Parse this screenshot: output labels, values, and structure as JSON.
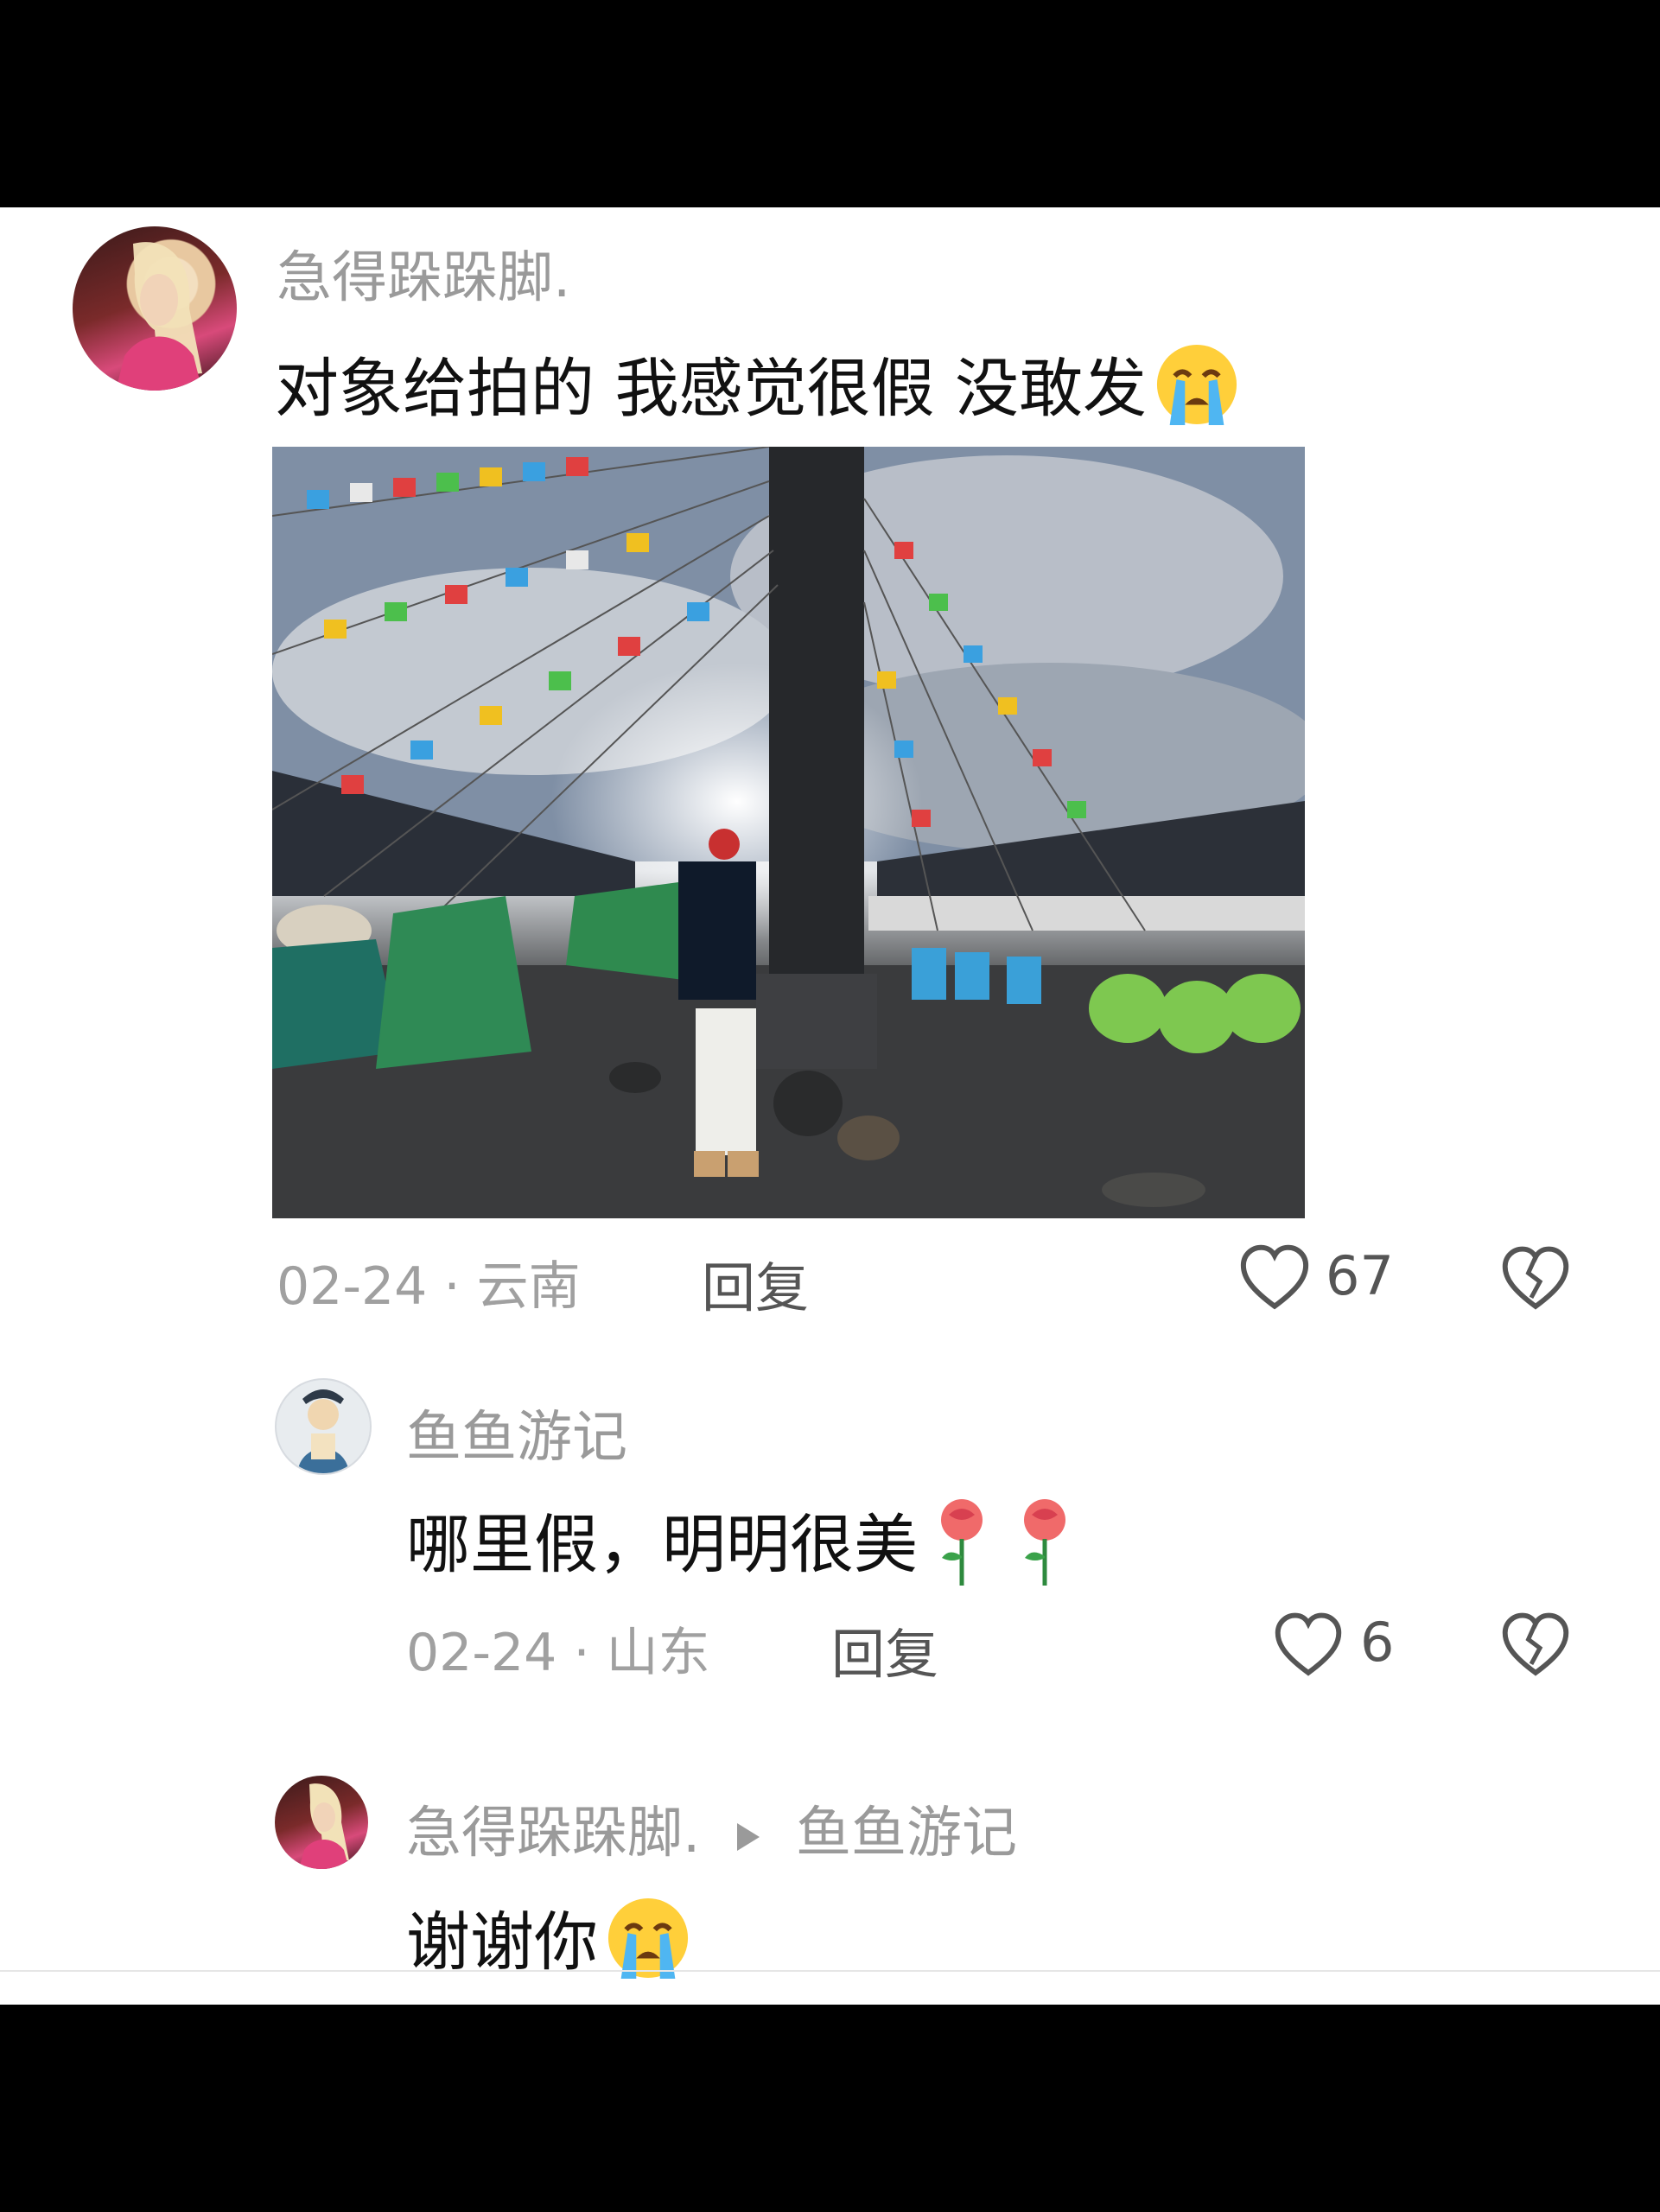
{
  "comments": [
    {
      "username": "急得跺跺脚.",
      "text": "对象给拍的 我感觉很假 没敢发",
      "emoji": "loudly-crying-face-emoji",
      "date": "02-24",
      "location": "云南",
      "reply_label": "回复",
      "likes": "67",
      "has_photo": true
    },
    {
      "username": "鱼鱼游记",
      "text": "哪里假，明明很美",
      "emoji": "rose-emoji",
      "date": "02-24",
      "location": "山东",
      "reply_label": "回复",
      "likes": "6"
    },
    {
      "username": "急得跺跺脚.",
      "reply_to": "鱼鱼游记",
      "text": "谢谢你",
      "emoji": "loudly-crying-face-emoji"
    }
  ],
  "separator": "·",
  "icons": {
    "like": "heart-outline-icon",
    "dislike": "broken-heart-icon",
    "reply_arrow": "triangle-right-icon"
  },
  "colors": {
    "username": "#9a9a9a",
    "meta": "#a0a0a0",
    "text": "#111111",
    "background": "#ffffff"
  }
}
